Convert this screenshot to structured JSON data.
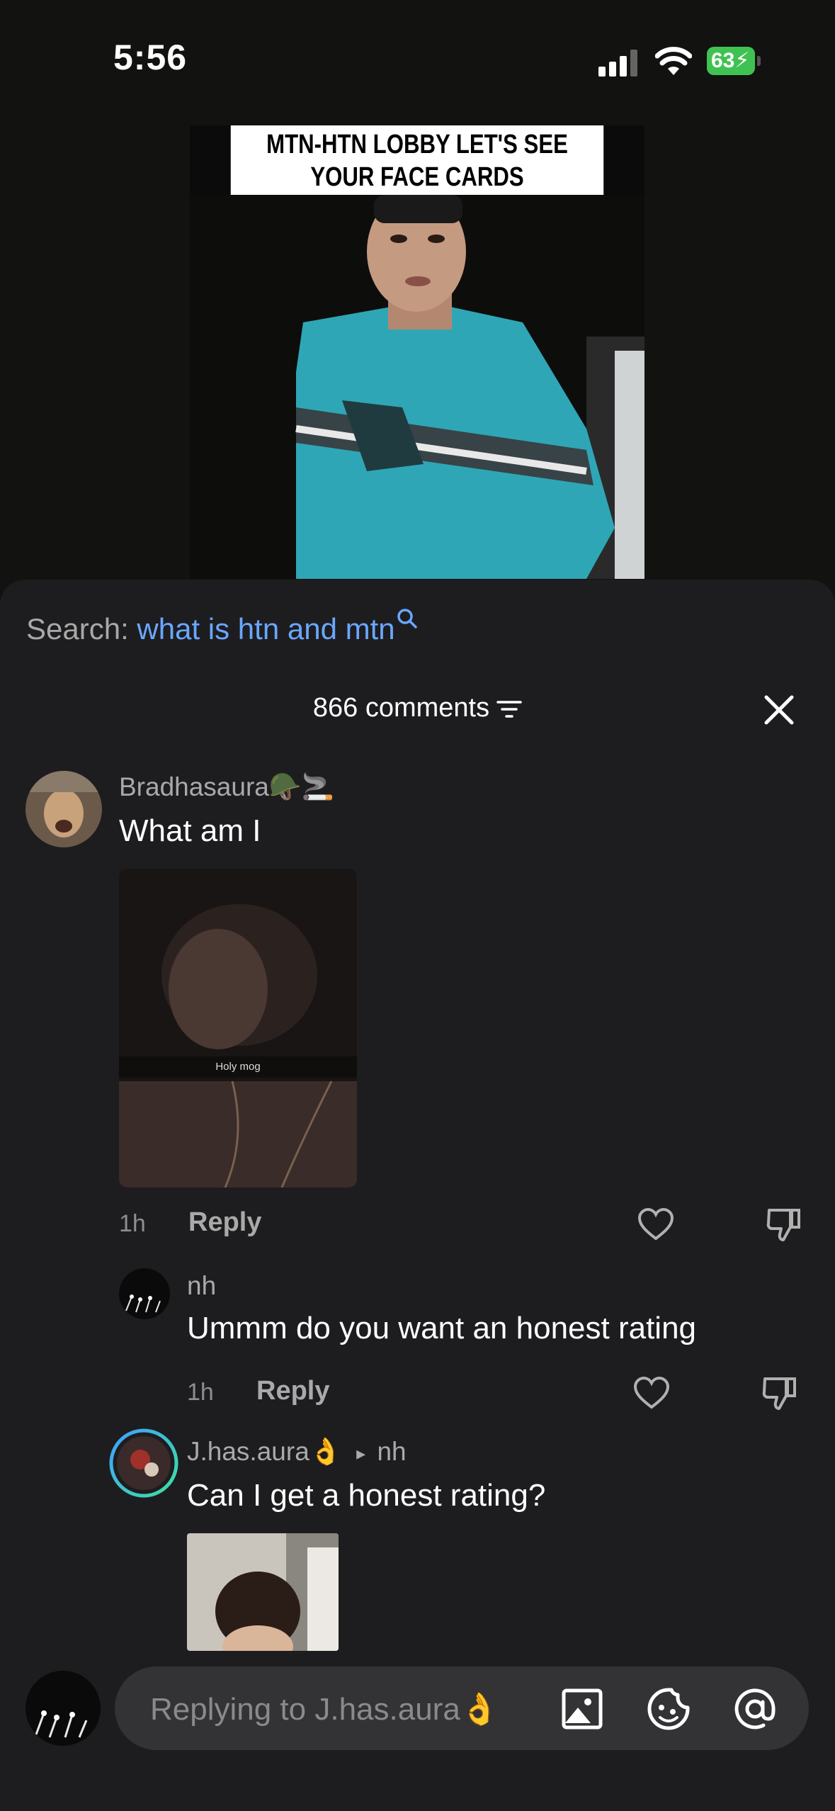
{
  "status_bar": {
    "time": "5:56",
    "battery": "63"
  },
  "video": {
    "caption": "MTN-HTN LOBBY LET'S SEE\nYOUR FACE CARDS"
  },
  "search": {
    "label": "Search: ",
    "query": "what is htn and mtn"
  },
  "comments_header": {
    "count_label": "866 comments"
  },
  "comments": [
    {
      "username": "Bradhasaura🪖🚬",
      "text": "What am I",
      "image_text": "Holy mog",
      "time": "1h",
      "reply_label": "Reply"
    },
    {
      "username": "nh",
      "text": "Ummm do you want an honest rating",
      "time": "1h",
      "reply_label": "Reply"
    },
    {
      "username": "J.has.aura👌",
      "reply_to": "nh",
      "text": "Can I get a honest rating?"
    }
  ],
  "input": {
    "placeholder": "Replying to J.has.aura👌"
  },
  "colors": {
    "accent_link": "#6aa7ff",
    "sheet_bg": "#1d1d1f",
    "battery_green": "#3fc251"
  }
}
